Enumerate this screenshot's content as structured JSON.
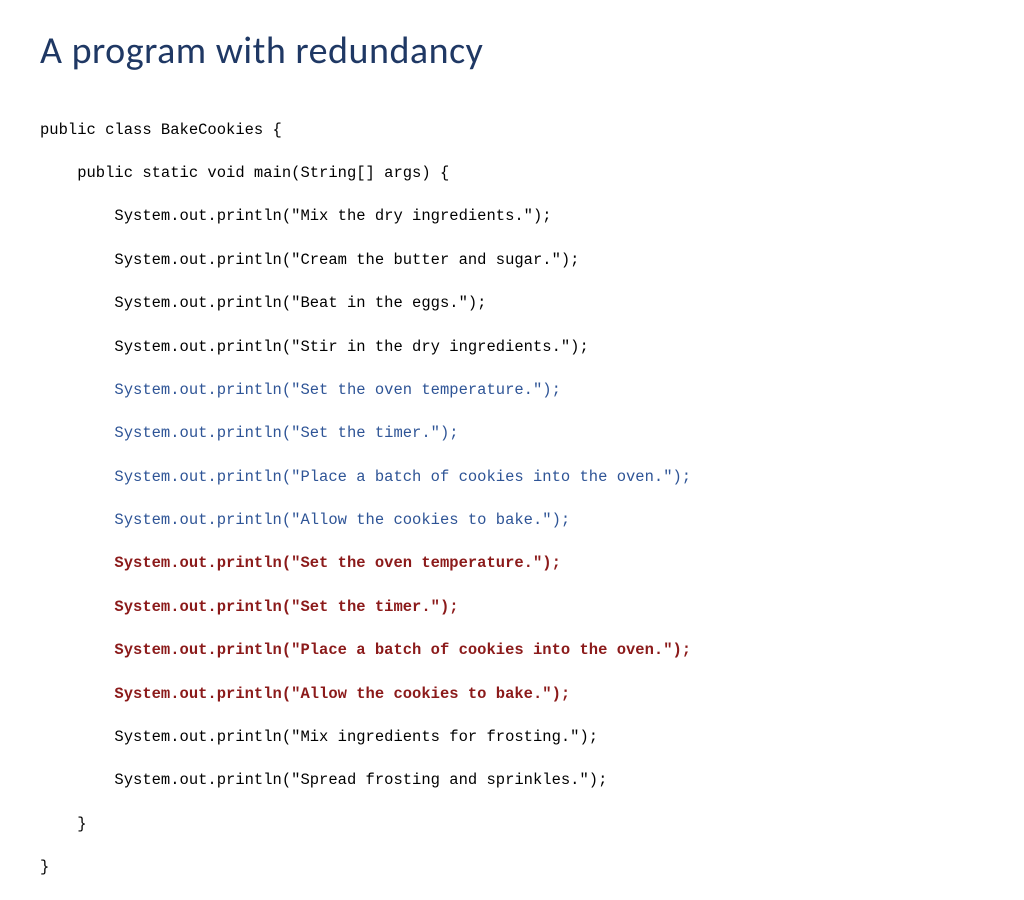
{
  "title": "A program with redundancy",
  "code": {
    "classDecl": "public class BakeCookies {",
    "methodDecl": "    public static void main(String[] args) {",
    "l1": "        System.out.println(\"Mix the dry ingredients.\");",
    "l2": "        System.out.println(\"Cream the butter and sugar.\");",
    "l3": "        System.out.println(\"Beat in the eggs.\");",
    "l4": "        System.out.println(\"Stir in the dry ingredients.\");",
    "l5": "        System.out.println(\"Set the oven temperature.\");",
    "l6": "        System.out.println(\"Set the timer.\");",
    "l7": "        System.out.println(\"Place a batch of cookies into the oven.\");",
    "l8": "        System.out.println(\"Allow the cookies to bake.\");",
    "l9": "        System.out.println(\"Set the oven temperature.\");",
    "l10": "        System.out.println(\"Set the timer.\");",
    "l11": "        System.out.println(\"Place a batch of cookies into the oven.\");",
    "l12": "        System.out.println(\"Allow the cookies to bake.\");",
    "l13": "        System.out.println(\"Mix ingredients for frosting.\");",
    "l14": "        System.out.println(\"Spread frosting and sprinkles.\");",
    "closeMethod": "    }",
    "closeClass": "}"
  }
}
